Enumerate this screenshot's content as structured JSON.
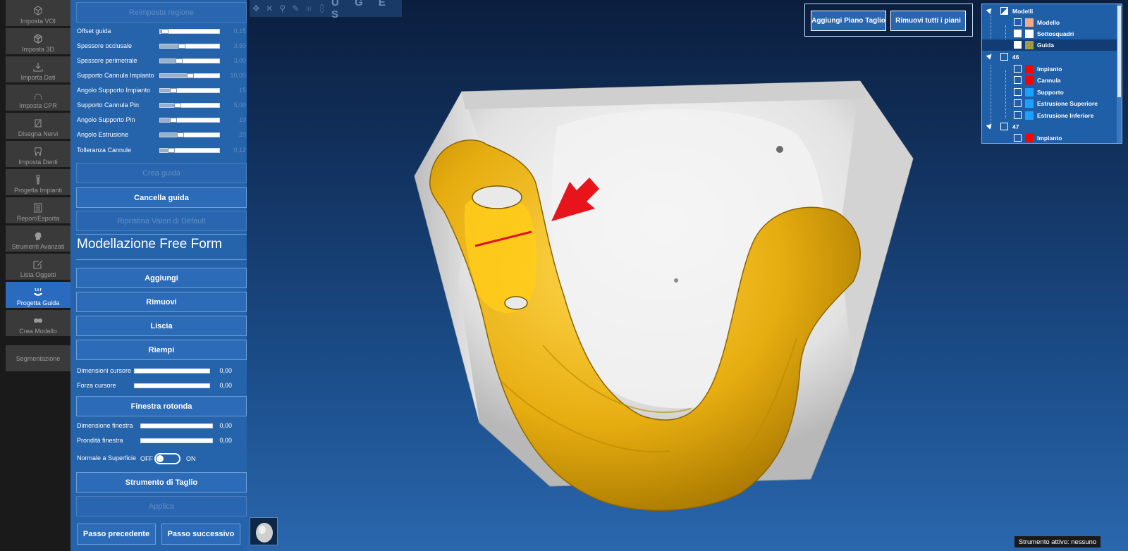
{
  "leftbar": {
    "items": [
      {
        "label": "Imposta VOI",
        "icon": "cube-icon"
      },
      {
        "label": "Imposta 3D",
        "icon": "3d-box-icon"
      },
      {
        "label": "Importa Dati",
        "icon": "download-icon"
      },
      {
        "label": "Imposta CPR",
        "icon": "arch-curve-icon"
      },
      {
        "label": "Disegna Nervi",
        "icon": "nerve-pen-icon"
      },
      {
        "label": "Imposta Denti",
        "icon": "tooth-icon"
      },
      {
        "label": "Progetta Impianti",
        "icon": "implant-icon"
      },
      {
        "label": "Report/Esporta",
        "icon": "report-icon"
      },
      {
        "label": "Strumenti Avanzati",
        "icon": "head-tools-icon"
      },
      {
        "label": "Lista Oggetti",
        "icon": "edit-list-icon"
      },
      {
        "label": "Progetta Guida",
        "icon": "guide-icon"
      },
      {
        "label": "Crea Modello",
        "icon": "model-icon"
      },
      {
        "label": "Segmentazione",
        "icon": ""
      }
    ],
    "active": "Progetta Guida"
  },
  "panel": {
    "reset_region": "Reimposta regione",
    "sliders": [
      {
        "label": "Offset guida",
        "value": "0,15",
        "fraction": 0.1
      },
      {
        "label": "Spessore occlusale",
        "value": "3,50",
        "fraction": 0.35
      },
      {
        "label": "Spessore perimetrale",
        "value": "3,00",
        "fraction": 0.3
      },
      {
        "label": "Supporto Cannula Impianto",
        "value": "10,00",
        "fraction": 0.5
      },
      {
        "label": "Angolo Supporto Impianto",
        "value": "15",
        "fraction": 0.15
      },
      {
        "label": "Supporto Cannula Pin",
        "value": "5,00",
        "fraction": 0.25
      },
      {
        "label": "Angolo Supporto Pin",
        "value": "10",
        "fraction": 0.15
      },
      {
        "label": "Angolo Estrusione",
        "value": "20",
        "fraction": 0.3
      },
      {
        "label": "Tolleranza Cannule",
        "value": "0,12",
        "fraction": 0.12
      }
    ],
    "create_guide": "Crea guida",
    "delete_guide": "Cancella guida",
    "restore_defaults": "Ripristina Valori di Default",
    "freeform_title": "Modellazione Free Form",
    "add": "Aggiungi",
    "remove": "Rimuovi",
    "smooth": "Liscia",
    "fill": "Riempi",
    "cursor_size": {
      "label": "Dimensioni cursore",
      "value": "0,00"
    },
    "cursor_force": {
      "label": "Forza cursore",
      "value": "0,00"
    },
    "round_window": "Finestra rotonda",
    "window_size": {
      "label": "Dimensione finestra",
      "value": "0,00"
    },
    "window_depth": {
      "label": "Prondità finestra",
      "value": "0,00"
    },
    "normal_surface": {
      "label": "Normale a Superficie",
      "off": "OFF",
      "on": "ON"
    },
    "cut_tool": "Strumento di Taglio",
    "apply": "Applica",
    "prev_step": "Passo precedente",
    "next_step": "Passo successivo"
  },
  "viewport": {
    "toolbar_letters": "U G E S",
    "add_cut_plane": "Aggiungi Piano Taglio",
    "remove_all_planes": "Rimuovi tutti i piani",
    "status": "Strumento attivo: nessuno"
  },
  "tree": {
    "root": "Modelli",
    "models": [
      {
        "label": "Modello",
        "color": "#f3a98a"
      },
      {
        "label": "Sottosquadri",
        "color": "#ffffff"
      },
      {
        "label": "Guida",
        "color": "#a39a48"
      }
    ],
    "group46": "46",
    "group46_items": [
      {
        "label": "Impianto",
        "color": "#ff0000"
      },
      {
        "label": "Cannula",
        "color": "#ff0000"
      },
      {
        "label": "Supporto",
        "color": "#1da1ff"
      },
      {
        "label": "Estrusione Superiore",
        "color": "#1da1ff"
      },
      {
        "label": "Estrusione Inferiore",
        "color": "#1da1ff"
      }
    ],
    "group47": "47",
    "group47_items": [
      {
        "label": "Impianto",
        "color": "#ff0000"
      }
    ]
  },
  "colors": {
    "panel": "#2563ab",
    "guide": "#e8b00c",
    "model": "#eeeeee",
    "accent_red": "#e0121e"
  }
}
